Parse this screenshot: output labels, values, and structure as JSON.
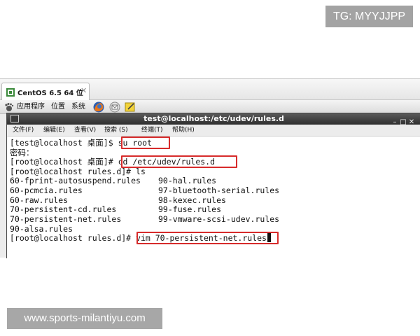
{
  "watermarks": {
    "top": "TG: MYYJJPP",
    "bottom": "www.sports-milantiyu.com"
  },
  "vm_tab": {
    "label": "CentOS 6.5 64 位",
    "close": "✕"
  },
  "gnome_panel": {
    "menus": [
      "应用程序",
      "位置",
      "系统"
    ]
  },
  "terminal": {
    "title": "test@localhost:/etc/udev/rules.d",
    "menu": [
      "文件(F)",
      "编辑(E)",
      "查看(V)",
      "搜索 (S)",
      "终端(T)",
      "帮助(H)"
    ],
    "lines": [
      {
        "prompt": "[test@localhost 桌面]$ ",
        "cmd": "su root"
      },
      {
        "text": "密码："
      },
      {
        "prompt": "[root@localhost 桌面]# ",
        "cmd": "cd /etc/udev/rules.d"
      },
      {
        "prompt": "[root@localhost rules.d]# ",
        "cmd": "ls"
      },
      {
        "col1": "60-fprint-autosuspend.rules",
        "col2": "90-hal.rules"
      },
      {
        "col1": "60-pcmcia.rules",
        "col2": "97-bluetooth-serial.rules"
      },
      {
        "col1": "60-raw.rules",
        "col2": "98-kexec.rules"
      },
      {
        "col1": "70-persistent-cd.rules",
        "col2": "99-fuse.rules"
      },
      {
        "col1": "70-persistent-net.rules",
        "col2": "99-vmware-scsi-udev.rules"
      },
      {
        "col1": "90-alsa.rules",
        "col2": ""
      },
      {
        "prompt": "[root@localhost rules.d]# ",
        "cmd": "vim 70-persistent-net.rules"
      }
    ]
  },
  "colors": {
    "highlight": "#d72b2b",
    "terminal_bg": "#ffffff",
    "titlebar": "#3a3a3a"
  }
}
